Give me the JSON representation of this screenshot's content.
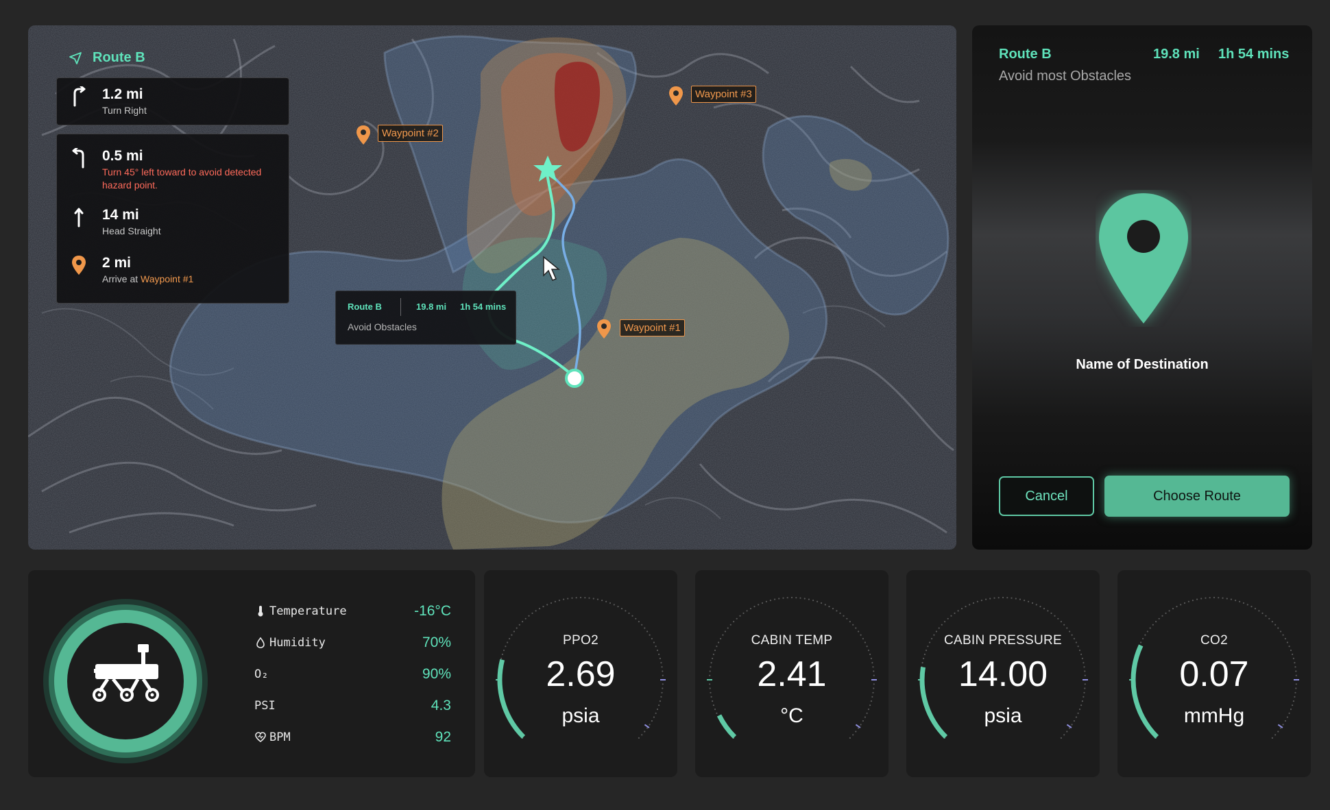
{
  "map": {
    "route_name": "Route B",
    "steps": [
      {
        "distance": "1.2 mi",
        "description": "Turn Right",
        "icon": "turn-right-icon"
      },
      {
        "distance": "0.5 mi",
        "description": "Turn 45° left toward to avoid detected hazard point.",
        "icon": "turn-left-icon",
        "warning": true
      },
      {
        "distance": "14 mi",
        "description": "Head Straight",
        "icon": "straight-arrow-icon"
      },
      {
        "distance": "2 mi",
        "description_prefix": "Arrive at ",
        "description_highlight": "Waypoint #1",
        "icon": "location-pin-icon"
      }
    ],
    "waypoints": [
      "Waypoint #1",
      "Waypoint #2",
      "Waypoint #3"
    ],
    "tooltip": {
      "route": "Route B",
      "distance": "19.8 mi",
      "time": "1h 54 mins",
      "description": "Avoid Obstacles"
    }
  },
  "destination": {
    "route": "Route B",
    "distance": "19.8 mi",
    "time": "1h 54 mins",
    "subtitle": "Avoid most Obstacles",
    "name": "Name of Destination",
    "cancel_label": "Cancel",
    "choose_label": "Choose Route"
  },
  "stats": [
    {
      "label": "Temperature",
      "value": "-16°C",
      "icon": "thermometer-icon"
    },
    {
      "label": "Humidity",
      "value": "70%",
      "icon": "droplet-icon"
    },
    {
      "label": "O₂",
      "value": "90%",
      "icon": ""
    },
    {
      "label": "PSI",
      "value": "4.3",
      "icon": ""
    },
    {
      "label": "BPM",
      "value": "92",
      "icon": "heart-icon"
    }
  ],
  "gauges": [
    {
      "label": "PPO2",
      "value": "2.69",
      "unit": "psia",
      "fill": 0.22
    },
    {
      "label": "CABIN TEMP",
      "value": "2.41",
      "unit": "°C",
      "fill": 0.07
    },
    {
      "label": "CABIN PRESSURE",
      "value": "14.00",
      "unit": "psia",
      "fill": 0.2
    },
    {
      "label": "CO2",
      "value": "0.07",
      "unit": "mmHg",
      "fill": 0.26
    }
  ],
  "colors": {
    "accent": "#5fe3bb",
    "waypoint": "#f0974a",
    "warning": "#ff6b5b",
    "background": "#262626",
    "panel": "#1c1c1c"
  }
}
